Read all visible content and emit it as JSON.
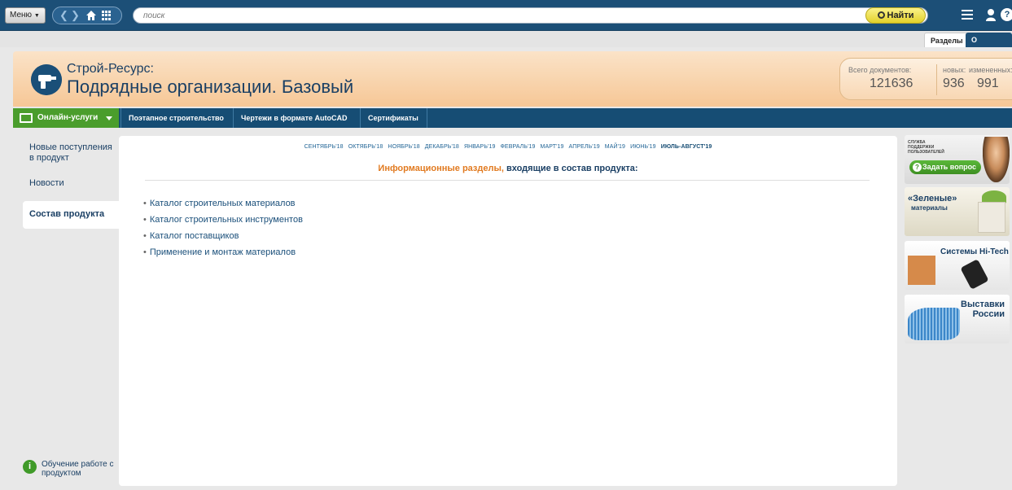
{
  "topbar": {
    "menu_label": "Меню",
    "search_placeholder": "поиск",
    "find_label": "Найти",
    "help_label": "?"
  },
  "tabs": {
    "sections": "Разделы",
    "about": "О системе"
  },
  "banner": {
    "brand_small": "Строй-Ресурс:",
    "brand_big": "Подрядные организации. Базовый",
    "stats": {
      "total_label": "Всего документов:",
      "total_value": "121636",
      "new_label": "новых:",
      "new_value": "936",
      "changed_label": "измененных:",
      "changed_value": "991"
    }
  },
  "mainnav": {
    "online": "Онлайн-услуги",
    "items": [
      "Поэтапное строительство",
      "Чертежи в формате AutoCAD",
      "Сертификаты"
    ]
  },
  "sidebar": {
    "items": [
      "Новые поступления в продукт",
      "Новости",
      "Состав продукта"
    ],
    "training": "Обучение работе с продуктом"
  },
  "content": {
    "months": [
      "СЕНТЯБРЬ'18",
      "ОКТЯБРЬ'18",
      "НОЯБРЬ'18",
      "ДЕКАБРЬ'18",
      "ЯНВАРЬ'19",
      "ФЕВРАЛЬ'19",
      "МАРТ'19",
      "АПРЕЛЬ'19",
      "МАЙ'19",
      "ИЮНЬ'19",
      "ИЮЛЬ-АВГУСТ'19"
    ],
    "heading_orange": "Информационные разделы,",
    "heading_blue": "входящие в состав продукта:",
    "items": [
      "Каталог строительных материалов",
      "Каталог строительных инструментов",
      "Каталог поставщиков",
      "Применение и монтаж материалов"
    ]
  },
  "ads": {
    "support_small": "СЛУЖБА ПОДДЕРЖКИ ПОЛЬЗОВАТЕЛЕЙ",
    "support_button": "Задать вопрос",
    "green_title": "«Зеленые»",
    "green_sub": "материалы",
    "hitech_title": "Системы Hi-Tech",
    "expo_title": "Выставки России"
  }
}
